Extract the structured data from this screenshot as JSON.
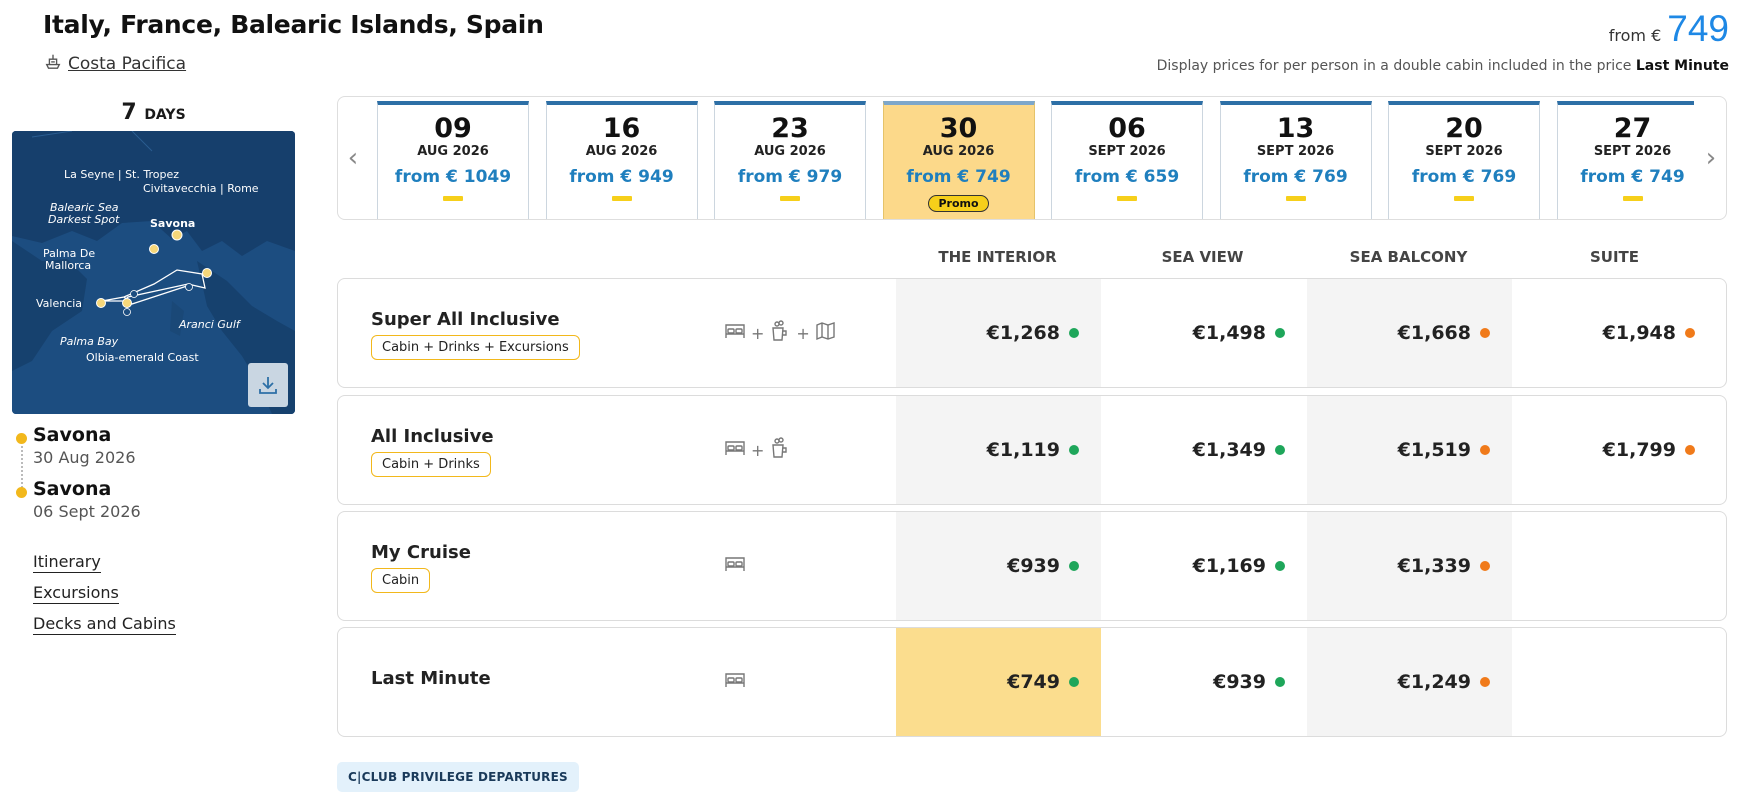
{
  "header": {
    "title": "Italy, France, Balearic Islands, Spain",
    "ship_name": "Costa Pacifica",
    "ship_icon": "ship-icon",
    "from_label": "from €",
    "from_value": "749",
    "display_note_prefix": "Display prices for per person in a double cabin included in the price",
    "display_note_bold": "Last Minute"
  },
  "sidebar": {
    "days_number": "7",
    "days_unit": "DAYS",
    "map": {
      "labels": [
        "La Seyne | St. Tropez",
        "Civitavecchia | Rome",
        "Balearic Sea",
        "Darkest Spot",
        "Savona",
        "Palma De",
        "Mallorca",
        "Valencia",
        "Aranci Gulf",
        "Palma Bay",
        "Olbia-emerald Coast"
      ],
      "download_icon": "download-icon"
    },
    "ports": [
      {
        "name": "Savona",
        "date": "30 Aug 2026"
      },
      {
        "name": "Savona",
        "date": "06 Sept 2026"
      }
    ],
    "links": [
      "Itinerary",
      "Excursions",
      "Decks and Cabins"
    ]
  },
  "dates": {
    "prev_icon": "chevron-left-icon",
    "next_icon": "chevron-right-icon",
    "items": [
      {
        "day": "09",
        "month": "AUG 2026",
        "price": "from € 1049"
      },
      {
        "day": "16",
        "month": "AUG 2026",
        "price": "from € 949"
      },
      {
        "day": "23",
        "month": "AUG 2026",
        "price": "from € 979"
      },
      {
        "day": "30",
        "month": "AUG 2026",
        "price": "from € 749",
        "badge": "Promo",
        "selected": true
      },
      {
        "day": "06",
        "month": "SEPT 2026",
        "price": "from € 659"
      },
      {
        "day": "13",
        "month": "SEPT 2026",
        "price": "from € 769"
      },
      {
        "day": "20",
        "month": "SEPT 2026",
        "price": "from € 769"
      },
      {
        "day": "27",
        "month": "SEPT 2026",
        "price": "from € 749"
      }
    ]
  },
  "table": {
    "columns": [
      "THE INTERIOR",
      "SEA VIEW",
      "SEA BALCONY",
      "SUITE"
    ],
    "rows": [
      {
        "name": "Super All Inclusive",
        "tag": "Cabin + Drinks + Excursions",
        "icons": [
          "bed-icon",
          "drink-icon",
          "map-icon"
        ],
        "prices": [
          {
            "value": "€1,268",
            "status": "green"
          },
          {
            "value": "€1,498",
            "status": "green"
          },
          {
            "value": "€1,668",
            "status": "orange"
          },
          {
            "value": "€1,948",
            "status": "orange"
          }
        ]
      },
      {
        "name": "All Inclusive",
        "tag": "Cabin + Drinks",
        "icons": [
          "bed-icon",
          "drink-icon"
        ],
        "prices": [
          {
            "value": "€1,119",
            "status": "green"
          },
          {
            "value": "€1,349",
            "status": "green"
          },
          {
            "value": "€1,519",
            "status": "orange"
          },
          {
            "value": "€1,799",
            "status": "orange"
          }
        ]
      },
      {
        "name": "My Cruise",
        "tag": "Cabin",
        "icons": [
          "bed-icon"
        ],
        "prices": [
          {
            "value": "€939",
            "status": "green"
          },
          {
            "value": "€1,169",
            "status": "green"
          },
          {
            "value": "€1,339",
            "status": "orange"
          }
        ]
      },
      {
        "name": "Last Minute",
        "tag": "",
        "icons": [
          "bed-icon"
        ],
        "highlight_first": true,
        "prices": [
          {
            "value": "€749",
            "status": "green"
          },
          {
            "value": "€939",
            "status": "green"
          },
          {
            "value": "€1,249",
            "status": "orange"
          }
        ]
      }
    ]
  },
  "status_colors": {
    "green": "#1ea65a",
    "orange": "#f07a1a",
    "accent": "#1e88e5",
    "highlight": "#fbdd8e"
  },
  "footer": {
    "club_label": "C|CLUB PRIVILEGE DEPARTURES"
  }
}
